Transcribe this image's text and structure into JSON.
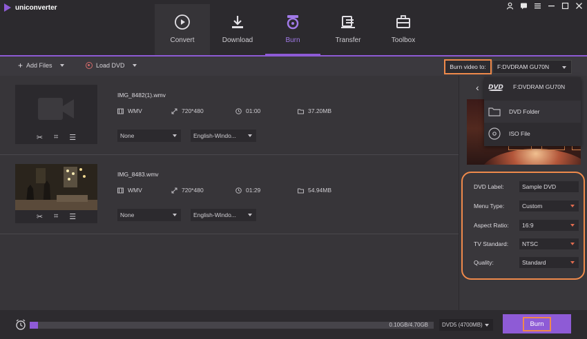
{
  "app": {
    "name": "uniconverter"
  },
  "window_controls": [
    "person-icon",
    "bell-icon",
    "menu-icon",
    "minimize-icon",
    "maximize-icon",
    "close-icon"
  ],
  "nav": {
    "tabs": [
      {
        "label": "Convert",
        "icon": "convert-icon"
      },
      {
        "label": "Download",
        "icon": "download-icon"
      },
      {
        "label": "Burn",
        "icon": "burn-disc-icon",
        "active": true
      },
      {
        "label": "Transfer",
        "icon": "transfer-icon"
      },
      {
        "label": "Toolbox",
        "icon": "toolbox-icon"
      }
    ]
  },
  "toolbar": {
    "add_files": "Add Files",
    "load_dvd": "Load DVD",
    "burn_to_label": "Burn video to:",
    "burn_to_value": "F:DVDRAM GU70N"
  },
  "files": [
    {
      "name": "IMG_8482(1).wmv",
      "format": "WMV",
      "resolution": "720*480",
      "duration": "01:00",
      "size": "37.20MB",
      "subtitle": "None",
      "audio": "English-Windo..."
    },
    {
      "name": "IMG_8483.wmv",
      "format": "WMV",
      "resolution": "720*480",
      "duration": "01:29",
      "size": "54.94MB",
      "subtitle": "None",
      "audio": "English-Windo..."
    }
  ],
  "dvd_menu": {
    "items": [
      {
        "label": "F:DVDRAM GU70N",
        "icon": "dvd-logo-icon"
      },
      {
        "label": "DVD Folder",
        "icon": "folder-icon"
      },
      {
        "label": "ISO File",
        "icon": "disc-icon"
      }
    ]
  },
  "settings": {
    "dvd_label": {
      "label": "DVD Label:",
      "value": "Sample DVD"
    },
    "menu_type": {
      "label": "Menu Type:",
      "value": "Custom"
    },
    "aspect_ratio": {
      "label": "Aspect Ratio:",
      "value": "16:9"
    },
    "tv_standard": {
      "label": "TV Standard:",
      "value": "NTSC"
    },
    "quality": {
      "label": "Quality:",
      "value": "Standard"
    }
  },
  "bottom": {
    "progress_text": "0.10GB/4.70GB",
    "progress_fraction": 0.021,
    "disc_type": "DVD5 (4700MB)",
    "burn_button": "Burn"
  },
  "colors": {
    "accent": "#8e5bd6",
    "highlight": "#f08a4b",
    "background": "#353338"
  }
}
